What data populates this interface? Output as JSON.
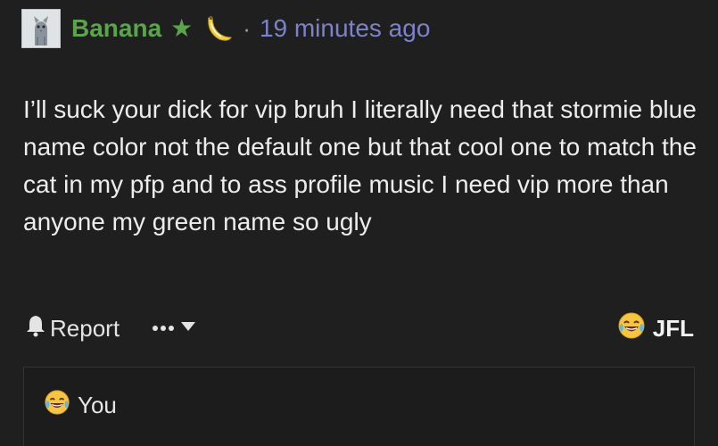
{
  "post": {
    "username": "Banana",
    "star_icon": "star-icon",
    "badge_icon": "banana-icon",
    "separator": "·",
    "timestamp": "19 minutes ago",
    "body": "I’ll suck your dick for vip bruh I literally need that stormie blue name color not the default one but that cool one to match the cat in my pfp and to ass profile music I need vip more than anyone my green name so ugly",
    "name_color": "#5aa44c",
    "time_color": "#7d83c9"
  },
  "actions": {
    "report_label": "Report",
    "reaction_label": "JFL"
  },
  "reply": {
    "label": "You"
  }
}
